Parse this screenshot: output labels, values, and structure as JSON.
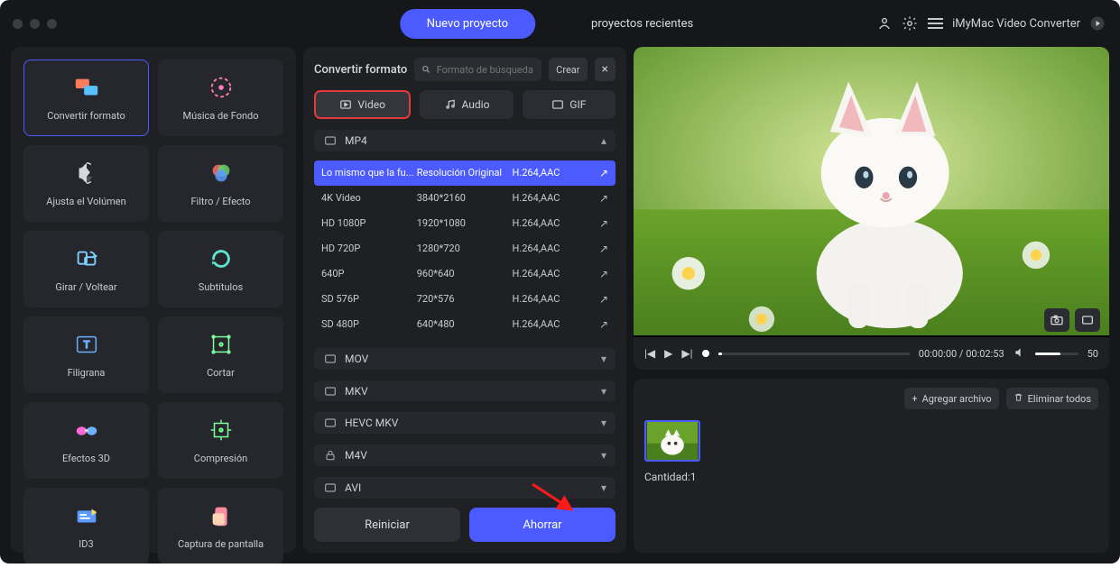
{
  "titlebar": {
    "tabs": {
      "new": "Nuevo proyecto",
      "recent": "proyectos recientes"
    },
    "app": "iMyMac Video Converter"
  },
  "tools": [
    {
      "id": "convert",
      "label": "Convertir formato",
      "active": true
    },
    {
      "id": "music",
      "label": "Música de Fondo"
    },
    {
      "id": "volume",
      "label": "Ajusta el Volúmen"
    },
    {
      "id": "filter",
      "label": "Filtro / Efecto"
    },
    {
      "id": "rotate",
      "label": "Girar / Voltear"
    },
    {
      "id": "subtitle",
      "label": "Subtítulos"
    },
    {
      "id": "watermark",
      "label": "Filigrana"
    },
    {
      "id": "crop",
      "label": "Cortar"
    },
    {
      "id": "fx3d",
      "label": "Efectos 3D"
    },
    {
      "id": "compress",
      "label": "Compresión"
    },
    {
      "id": "id3",
      "label": "ID3"
    },
    {
      "id": "screenshot",
      "label": "Captura de pantalla"
    }
  ],
  "mid": {
    "title": "Convertir formato",
    "search_placeholder": "Formato de búsqueda",
    "crear": "Crear",
    "close": "×",
    "type_tabs": {
      "video": "Video",
      "audio": "Audio",
      "gif": "GIF"
    },
    "sections": {
      "mp4": "MP4",
      "mov": "MOV",
      "mkv": "MKV",
      "hevcmkv": "HEVC MKV",
      "m4v": "M4V",
      "avi": "AVI"
    },
    "presets": [
      {
        "name": "Lo mismo que la fu...",
        "res": "Resolución Original",
        "codec": "H.264,AAC",
        "selected": true
      },
      {
        "name": "4K Video",
        "res": "3840*2160",
        "codec": "H.264,AAC"
      },
      {
        "name": "HD 1080P",
        "res": "1920*1080",
        "codec": "H.264,AAC"
      },
      {
        "name": "HD 720P",
        "res": "1280*720",
        "codec": "H.264,AAC"
      },
      {
        "name": "640P",
        "res": "960*640",
        "codec": "H.264,AAC"
      },
      {
        "name": "SD 576P",
        "res": "720*576",
        "codec": "H.264,AAC"
      },
      {
        "name": "SD 480P",
        "res": "640*480",
        "codec": "H.264,AAC"
      }
    ],
    "reset": "Reiniciar",
    "save": "Ahorrar"
  },
  "preview": {
    "time_current": "00:00:00",
    "time_sep": " / ",
    "time_total": "00:02:53",
    "volume": "50"
  },
  "bottom": {
    "add": "Agregar archivo",
    "clear": "Eliminar todos",
    "qty_label": "Cantidad:",
    "qty_val": "1"
  }
}
